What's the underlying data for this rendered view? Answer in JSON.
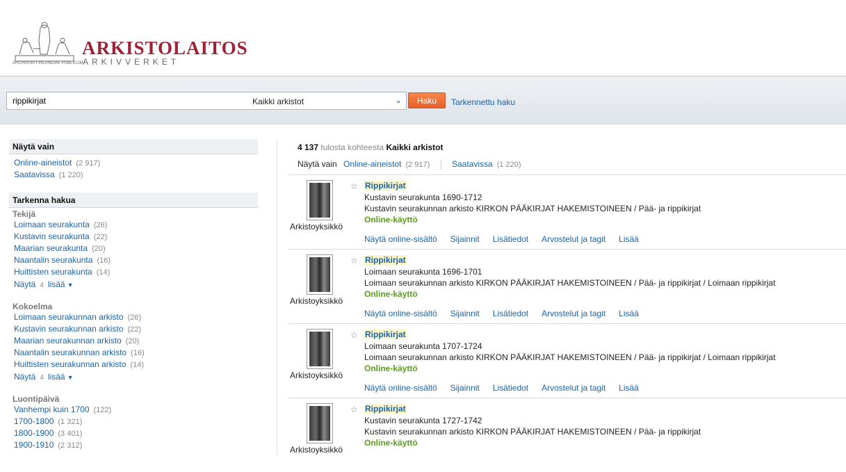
{
  "header": {
    "logo_title": "ARKISTOLAITOS",
    "logo_subtitle": "ARKIVVERKET",
    "logo_latin": "ARCHIVUM FINLANDIAE PUBLICUM"
  },
  "search": {
    "query": "rippikirjat",
    "scope": "Kaikki arkistot",
    "button": "Haku",
    "advanced": "Tarkennettu haku"
  },
  "sidebar": {
    "show_only": {
      "heading": "Näytä vain",
      "items": [
        {
          "label": "Online-aineistot",
          "count": "(2 917)"
        },
        {
          "label": "Saatavissa",
          "count": "(1 220)"
        }
      ]
    },
    "refine_heading": "Tarkenna hakua",
    "groups": [
      {
        "title": "Tekijä",
        "items": [
          {
            "label": "Loimaan seurakunta",
            "count": "(26)"
          },
          {
            "label": "Kustavin seurakunta",
            "count": "(22)"
          },
          {
            "label": "Maarian seurakunta",
            "count": "(20)"
          },
          {
            "label": "Naantalin seurakunta",
            "count": "(16)"
          },
          {
            "label": "Huittisten seurakunta",
            "count": "(14)"
          }
        ],
        "more": {
          "show": "Näytä",
          "num": "4",
          "more": "lisää"
        }
      },
      {
        "title": "Kokoelma",
        "items": [
          {
            "label": "Loimaan seurakunnan arkisto",
            "count": "(26)"
          },
          {
            "label": "Kustavin seurakunnan arkisto",
            "count": "(22)"
          },
          {
            "label": "Maarian seurakunnan arkisto",
            "count": "(20)"
          },
          {
            "label": "Naantalin seurakunnan arkisto",
            "count": "(16)"
          },
          {
            "label": "Huittisten seurakunnan arkisto",
            "count": "(14)"
          }
        ],
        "more": {
          "show": "Näytä",
          "num": "4",
          "more": "lisää"
        }
      },
      {
        "title": "Luontipäivä",
        "items": [
          {
            "label": "Vanhempi kuin 1700",
            "count": "(122)"
          },
          {
            "label": "1700-1800",
            "count": "(1 321)"
          },
          {
            "label": "1800-1900",
            "count": "(3 401)"
          },
          {
            "label": "1900-1910",
            "count": "(2 312)"
          }
        ]
      }
    ]
  },
  "results": {
    "summary": {
      "count": "4 137",
      "middle": "tulosta kohteesta",
      "scope": "Kaikki arkistot"
    },
    "filter": {
      "label": "Näytä vain",
      "items": [
        {
          "label": "Online-aineistot",
          "count": "(2 917)"
        },
        {
          "label": "Saatavissa",
          "count": "(1 220)"
        }
      ]
    },
    "items": [
      {
        "type": "Arkistoyksikkö",
        "title": "Rippikirjat",
        "line1": "Kustavin seurakunta 1690-1712",
        "line2": "Kustavin seurakunnan arkisto KIRKON PÄÄKIRJAT HAKEMISTOINEEN / Pää- ja rippikirjat",
        "online": "Online-käyttö"
      },
      {
        "type": "Arkistoyksikkö",
        "title": "Rippikirjat",
        "line1": "Loimaan seurakunta 1696-1701",
        "line2": "Loimaan seurakunnan arkisto KIRKON PÄÄKIRJAT HAKEMISTOINEEN / Pää- ja rippikirjat / Loimaan rippikirjat",
        "online": "Online-käyttö"
      },
      {
        "type": "Arkistoyksikkö",
        "title": "Rippikirjat",
        "line1": "Loimaan seurakunta 1707-1724",
        "line2": "Loimaan seurakunnan arkisto KIRKON PÄÄKIRJAT HAKEMISTOINEEN / Pää- ja rippikirjat / Loimaan rippikirjat",
        "online": "Online-käyttö"
      },
      {
        "type": "Arkistoyksikkö",
        "title": "Rippikirjat",
        "line1": "Kustavin seurakunta 1727-1742",
        "line2": "Kustavin seurakunnan arkisto KIRKON PÄÄKIRJAT HAKEMISTOINEEN / Pää- ja rippikirjat",
        "online": "Online-käyttö"
      }
    ],
    "actions": [
      "Näytä online-sisältö",
      "Sijainnit",
      "Lisätiedot",
      "Arvostelut ja tagit",
      "Lisää"
    ]
  },
  "colors": {
    "brand": "#9b2335",
    "link": "#1a63a8",
    "online": "#5a9e1c",
    "button": "#f07038"
  }
}
